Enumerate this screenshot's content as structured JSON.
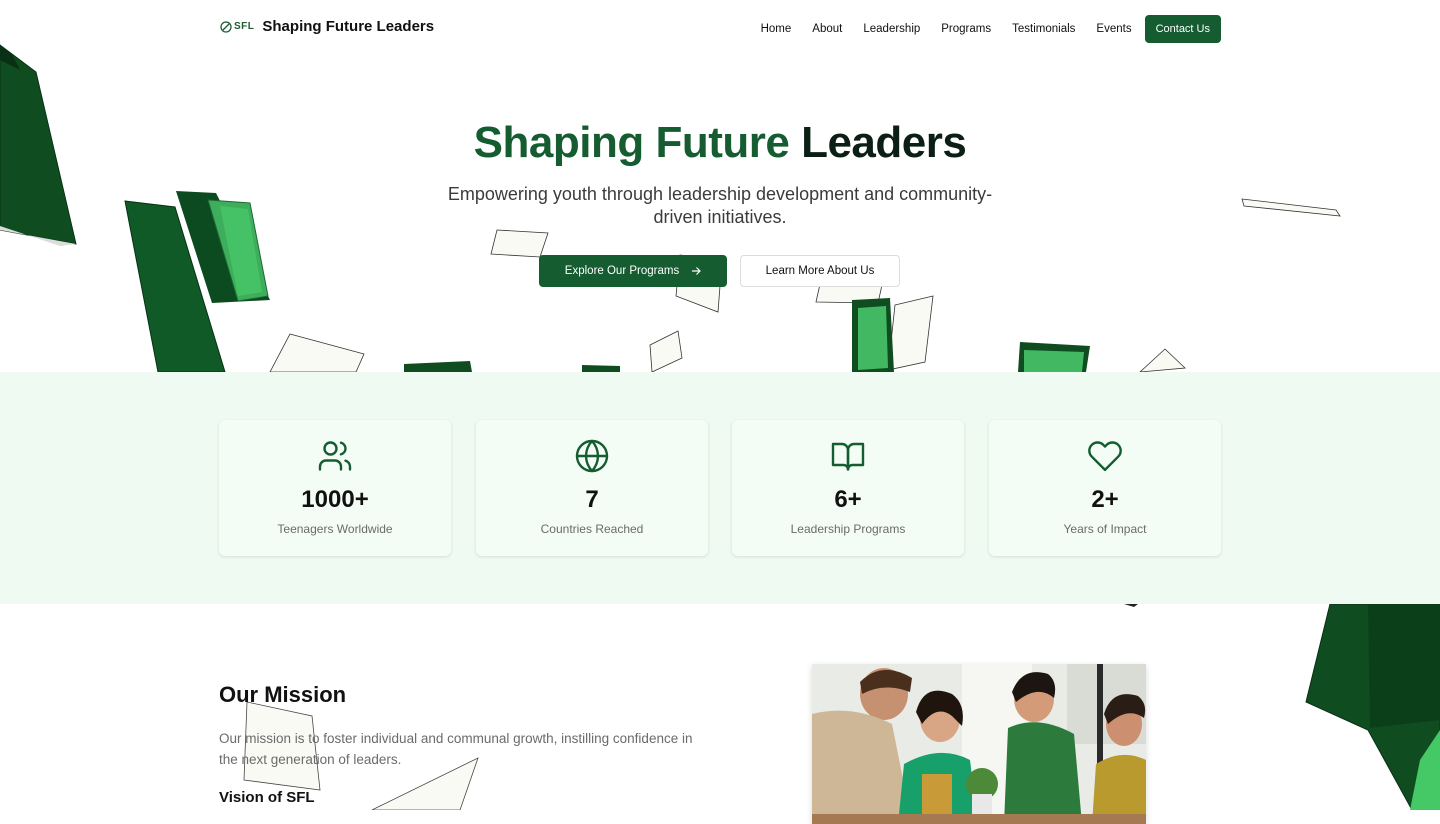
{
  "nav": {
    "logo_text": "SFL",
    "brand": "Shaping Future Leaders",
    "links": [
      "Home",
      "About",
      "Leadership",
      "Programs",
      "Testimonials",
      "Events"
    ],
    "cta": "Contact Us"
  },
  "hero": {
    "title_part1": "Shaping",
    "title_part2": "Future",
    "title_part3": "Leaders",
    "subtitle": "Empowering youth through leadership development and community-driven initiatives.",
    "primary_button": "Explore Our Programs",
    "secondary_button": "Learn More About Us"
  },
  "stats": [
    {
      "icon": "users-icon",
      "value": "1000+",
      "label": "Teenagers Worldwide"
    },
    {
      "icon": "globe-icon",
      "value": "7",
      "label": "Countries Reached"
    },
    {
      "icon": "book-open-icon",
      "value": "6+",
      "label": "Leadership Programs"
    },
    {
      "icon": "heart-icon",
      "value": "2+",
      "label": "Years of Impact"
    }
  ],
  "mission": {
    "title": "Our Mission",
    "text": "Our mission is to foster individual and communal growth, instilling confidence in the next generation of leaders.",
    "vision_title": "Vision of SFL"
  },
  "colors": {
    "brand_green": "#155c31",
    "stats_background": "#effbf2"
  }
}
